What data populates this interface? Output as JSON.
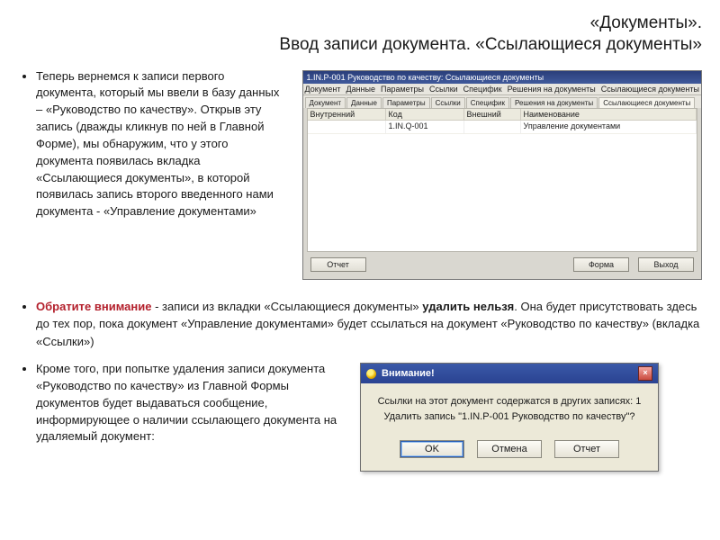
{
  "title": {
    "line1": "«Документы».",
    "line2": "Ввод записи документа. «Ссылающиеся документы»"
  },
  "para1": "Теперь вернемся к записи первого документа, который мы ввели в базу данных – «Руководство по качеству». Открыв эту запись (дважды кликнув по ней в Главной Форме), мы обнаружим, что у этого документа появилась вкладка «Ссылающиеся документы», в которой появилась запись второго введенного нами документа  - «Управление документами»",
  "win": {
    "title": "1.IN.P-001 Руководство по качеству: Ссылающиеся документы",
    "menu": [
      "Документ",
      "Данные",
      "Параметры",
      "Ссылки",
      "Специфик",
      "Решения на документы",
      "Ссылающиеся документы"
    ],
    "tabs": [
      "Документ",
      "Данные",
      "Параметры",
      "Ссылки",
      "Специфик",
      "Решения на документы",
      "Ссылающиеся документы"
    ],
    "active_tab": 6,
    "columns": [
      "Внутренний",
      "Код",
      "Внешний",
      "Наименование"
    ],
    "row": {
      "code": "1.IN.Q-001",
      "name": "Управление документами"
    },
    "buttons": {
      "ok": "Отчет",
      "form": "Форма",
      "exit": "Выход"
    }
  },
  "note": {
    "pre_bold1": "Обратите внимание",
    "mid": "  -  записи из вкладки «Ссылающиеся документы» ",
    "bold2": "удалить нельзя",
    "rest": ". Она будет присутствовать здесь до тех пор, пока документ «Управление документами» будет ссылаться на документ «Руководство по качеству» (вкладка «Ссылки»)"
  },
  "para3": "Кроме того, при попытке удаления записи документа «Руководство по качеству» из Главной Формы документов будет выдаваться сообщение, информирующее о наличии ссылающего документа на удаляемый документ:",
  "dialog": {
    "title": "Внимание!",
    "line1": "Ссылки на этот документ содержатся в других записях: 1",
    "line2": "Удалить запись \"1.IN.P-001 Руководство по качеству\"?",
    "ok": "OK",
    "cancel": "Отмена",
    "report": "Отчет"
  }
}
